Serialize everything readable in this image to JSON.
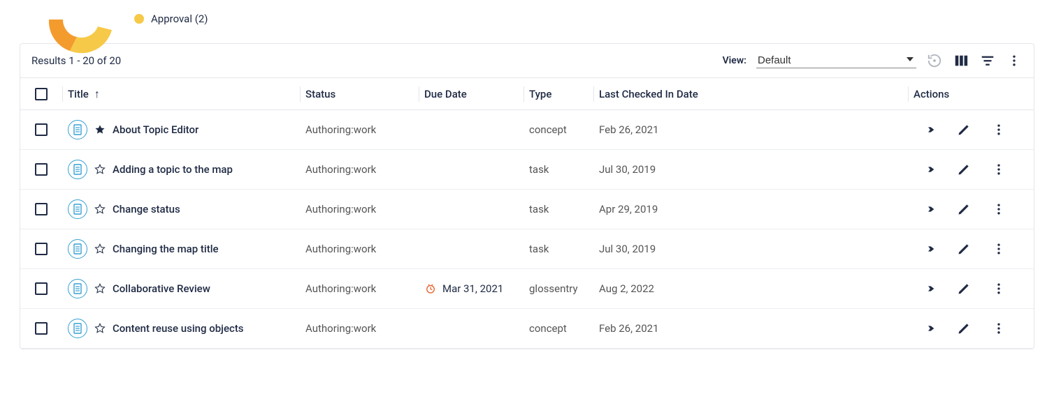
{
  "legend": {
    "approval_label": "Approval (2)"
  },
  "toolbar": {
    "results_text": "Results 1 - 20 of 20",
    "view_label": "View:",
    "view_value": "Default"
  },
  "columns": {
    "title": "Title",
    "status": "Status",
    "due_date": "Due Date",
    "type": "Type",
    "last_checked": "Last Checked In Date",
    "actions": "Actions"
  },
  "rows": [
    {
      "title": "About Topic Editor",
      "status": "Authoring:work",
      "due": "",
      "type": "concept",
      "checked": "Feb 26, 2021",
      "starred": true
    },
    {
      "title": "Adding a topic to the map",
      "status": "Authoring:work",
      "due": "",
      "type": "task",
      "checked": "Jul 30, 2019",
      "starred": false
    },
    {
      "title": "Change status",
      "status": "Authoring:work",
      "due": "",
      "type": "task",
      "checked": "Apr 29, 2019",
      "starred": false
    },
    {
      "title": "Changing the map title",
      "status": "Authoring:work",
      "due": "",
      "type": "task",
      "checked": "Jul 30, 2019",
      "starred": false
    },
    {
      "title": "Collaborative Review",
      "status": "Authoring:work",
      "due": "Mar 31, 2021",
      "type": "glossentry",
      "checked": "Aug 2, 2022",
      "starred": false,
      "overdue": true
    },
    {
      "title": "Content reuse using objects",
      "status": "Authoring:work",
      "due": "",
      "type": "concept",
      "checked": "Feb 26, 2021",
      "starred": false
    }
  ]
}
